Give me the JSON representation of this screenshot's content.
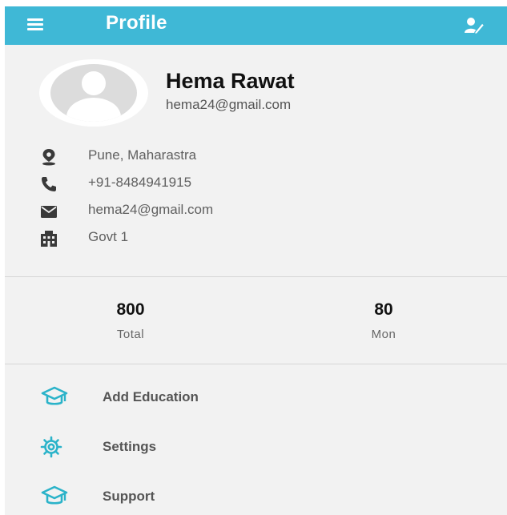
{
  "appbar": {
    "title": "Profile",
    "menu_icon": "hamburger-menu-icon",
    "edit_icon": "edit-profile-icon",
    "color": "#3fb8d6"
  },
  "profile": {
    "name": "Hema Rawat",
    "email": "hema24@gmail.com",
    "avatar_icon": "default-avatar-icon"
  },
  "info": {
    "location": {
      "icon": "location-pin-icon",
      "text": "Pune, Maharastra"
    },
    "phone": {
      "icon": "phone-icon",
      "text": "+91-8484941915"
    },
    "email": {
      "icon": "mail-icon",
      "text": "hema24@gmail.com"
    },
    "organization": {
      "icon": "building-icon",
      "text": "Govt 1"
    }
  },
  "stats": {
    "total": {
      "value": "800",
      "label": "Total"
    },
    "mon": {
      "value": "80",
      "label": "Mon"
    }
  },
  "menu": {
    "add_education": {
      "icon": "graduation-cap-icon",
      "label": "Add Education"
    },
    "settings": {
      "icon": "gear-icon",
      "label": "Settings"
    },
    "support": {
      "icon": "graduation-cap-icon",
      "label": "Support"
    },
    "accent_color": "#2bb3c9"
  }
}
